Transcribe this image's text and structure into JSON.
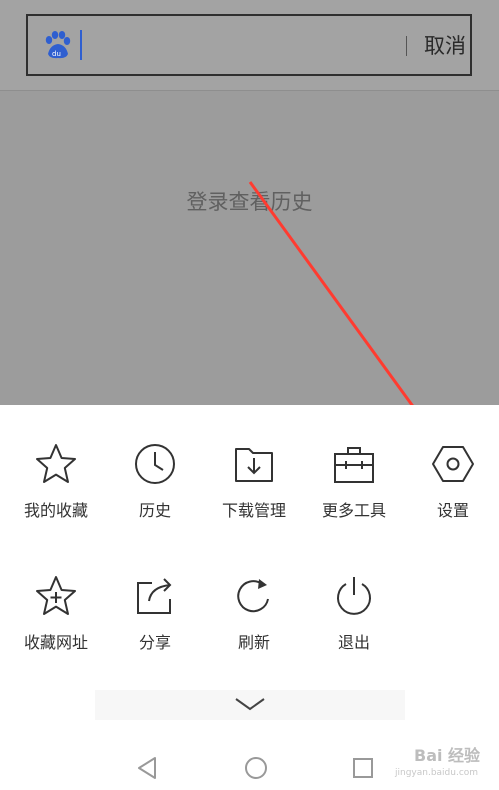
{
  "search": {
    "cancel_label": "取消"
  },
  "page": {
    "login_history_text": "登录查看历史"
  },
  "menu": {
    "row1": [
      {
        "label": "我的收藏",
        "icon": "star-icon"
      },
      {
        "label": "历史",
        "icon": "clock-icon"
      },
      {
        "label": "下载管理",
        "icon": "download-folder-icon"
      },
      {
        "label": "更多工具",
        "icon": "toolbox-icon"
      },
      {
        "label": "设置",
        "icon": "settings-hexagon-icon"
      }
    ],
    "row2": [
      {
        "label": "收藏网址",
        "icon": "star-plus-icon"
      },
      {
        "label": "分享",
        "icon": "share-icon"
      },
      {
        "label": "刷新",
        "icon": "refresh-icon"
      },
      {
        "label": "退出",
        "icon": "power-icon"
      }
    ]
  },
  "watermark": {
    "text": "Bai 经验",
    "sub": "jingyan.baidu.com"
  },
  "colors": {
    "annotation_arrow": "#ff3b30",
    "overlay": "#9c9c9c",
    "baidu_blue": "#2f5fd0"
  }
}
